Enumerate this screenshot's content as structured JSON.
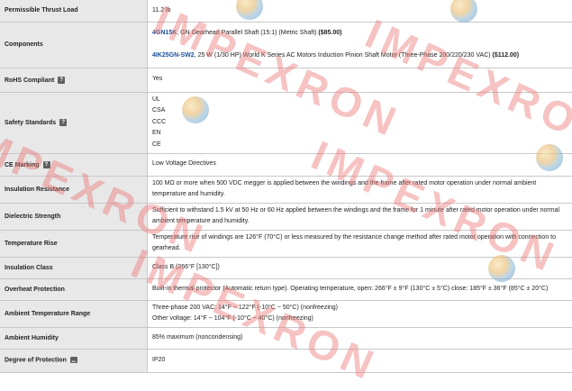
{
  "rows": [
    {
      "label": "Permissible Thrust Load",
      "lines": [
        "11.2 lb"
      ]
    },
    {
      "label": "Components",
      "components": [
        {
          "link": "4GN15K",
          "text": ", GN Gearhead Parallel Shaft (15:1) (Metric Shaft) ",
          "price": "($85.00)"
        },
        {
          "link": "4IK25GN-SW2",
          "text": ", 25 W (1/30 HP) World K Series AC Motors Induction Pinion Shaft Motor (Three-Phase 200/220/230 VAC) ",
          "price": "($112.00)"
        }
      ]
    },
    {
      "label": "RoHS Compliant",
      "icon": "?",
      "lines": [
        "Yes"
      ]
    },
    {
      "label": "Safety Standards",
      "icon": "?",
      "lines": [
        "UL",
        "CSA",
        "CCC",
        "EN",
        "CE"
      ]
    },
    {
      "label": "CE Marking",
      "icon": "?",
      "lines": [
        "Low Voltage Directives"
      ]
    },
    {
      "label": "Insulation Resistance",
      "lines": [
        "100 MΩ or more when 500 VDC megger is applied between the windings and the frame after rated motor operation under normal ambient temperature and humidity."
      ]
    },
    {
      "label": "Dielectric Strength",
      "lines": [
        "Sufficient to withstand 1.5 kV at 50 Hz or 60 Hz applied between the windings and the frame for 1 minute after rated motor operation under normal ambient temperature and humidity."
      ]
    },
    {
      "label": "Temperature Rise",
      "lines": [
        "Temperature rise of windings are 126°F (70°C) or less measured by the resistance change method after rated motor operation with connection to gearhead."
      ]
    },
    {
      "label": "Insulation Class",
      "lines": [
        "Class B (266°F [130°C])"
      ]
    },
    {
      "label": "Overheat Protection",
      "lines": [
        "Built-in thermal protector (Automatic return type). Operating temperature, open: 266°F ± 9°F (130°C ± 5°C) close: 185°F ± 36°F (85°C ± 20°C)"
      ]
    },
    {
      "label": "Ambient Temperature Range",
      "lines": [
        "Three-phase 200 VAC: 14°F ~ 122°F (-10°C ~ 50°C) (nonfreezing)",
        "Other voltage: 14°F ~ 104°F (-10°C ~ 40°C) (nonfreezing)"
      ]
    },
    {
      "label": "Ambient Humidity",
      "lines": [
        "85% maximum (noncondensing)"
      ]
    },
    {
      "label": "Degree of Protection",
      "icon": "image",
      "lines": [
        "IP20"
      ]
    }
  ],
  "watermark": {
    "text": "IMPEXRON"
  }
}
